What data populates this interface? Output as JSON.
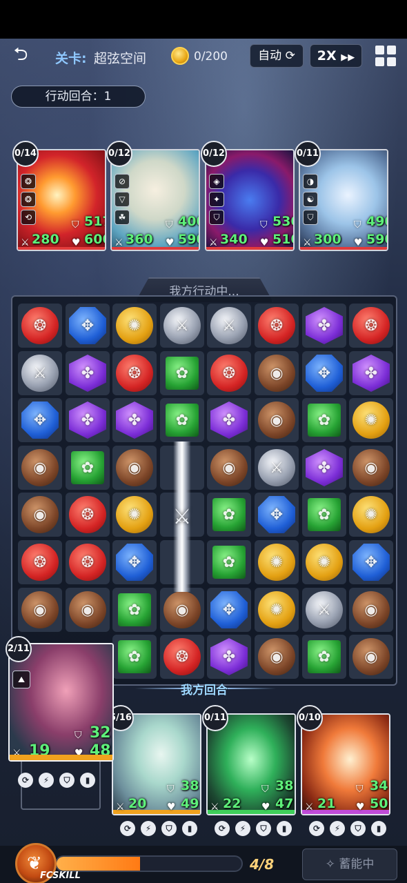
{
  "header": {
    "back_icon": "back-arrow-icon",
    "stage_label": "关卡:",
    "stage_name": "超弦空间",
    "coins": "0/200",
    "auto_label": "自动",
    "speed_label": "2X"
  },
  "turn_counter": "行动回合：1",
  "enemies": [
    {
      "count": "0/14",
      "defense": "517",
      "attack": "280",
      "health": "600",
      "icons": [
        "❂",
        "❂",
        "⟲"
      ]
    },
    {
      "count": "0/12",
      "defense": "400",
      "attack": "360",
      "health": "590",
      "icons": [
        "⊘",
        "▽",
        "☘"
      ]
    },
    {
      "count": "0/12",
      "defense": "530",
      "attack": "340",
      "health": "510",
      "icons": [
        "◈",
        "✦",
        "⛉"
      ]
    },
    {
      "count": "0/11",
      "defense": "490",
      "attack": "300",
      "health": "590",
      "icons": [
        "◑",
        "☯",
        "⛉"
      ]
    }
  ],
  "board": {
    "status": "我方行动中...",
    "footer": "我方回合",
    "grid": [
      [
        "red",
        "blue",
        "yellow",
        "silver",
        "silver",
        "red",
        "purple",
        "red"
      ],
      [
        "silver",
        "purple",
        "red",
        "green",
        "red",
        "brown",
        "blue",
        "purple"
      ],
      [
        "blue",
        "purple",
        "purple",
        "green",
        "purple",
        "brown",
        "green",
        "yellow"
      ],
      [
        "brown",
        "green",
        "brown",
        "sword",
        "brown",
        "silver",
        "purple",
        "brown"
      ],
      [
        "brown",
        "red",
        "yellow",
        "sword",
        "green",
        "blue",
        "green",
        "yellow"
      ],
      [
        "red",
        "red",
        "blue",
        "sword",
        "green",
        "yellow",
        "yellow",
        "blue"
      ],
      [
        "brown",
        "brown",
        "green",
        "brown",
        "blue",
        "yellow",
        "silver",
        "brown"
      ],
      [
        "",
        "",
        "green",
        "red",
        "purple",
        "brown",
        "green",
        "brown"
      ]
    ]
  },
  "active_hero": {
    "count": "2/11",
    "defense": "32",
    "attack": "19",
    "health": "48"
  },
  "heroes": [
    {
      "count": "5/16",
      "defense": "38",
      "attack": "20",
      "health": "49"
    },
    {
      "count": "0/11",
      "defense": "38",
      "attack": "22",
      "health": "47"
    },
    {
      "count": "0/10",
      "defense": "34",
      "attack": "21",
      "health": "50"
    }
  ],
  "skill_icons": [
    "⟳",
    "⚡",
    "⛉",
    "▮"
  ],
  "bottom": {
    "fc_label": "FCSKILL",
    "energy_text": "4/8",
    "energy_fraction": 0.45,
    "charge_label": "蓄能中"
  },
  "colors": {
    "gem_red": "#d42424",
    "gem_blue": "#1f5fd6",
    "gem_yellow": "#e3a012",
    "gem_purple": "#7b2dd6",
    "gem_green": "#27a334",
    "gem_brown": "#7c4528",
    "stat_green": "#5ef07a"
  }
}
